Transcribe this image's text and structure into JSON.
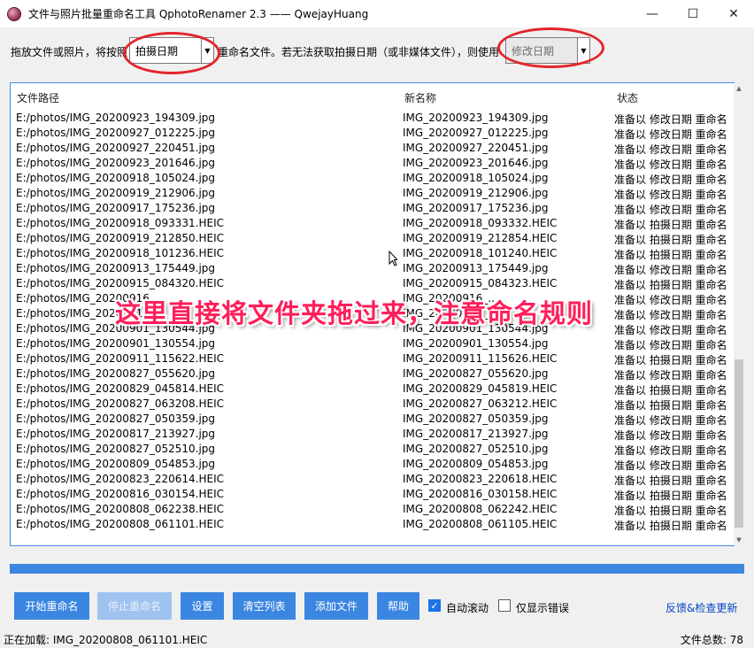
{
  "window": {
    "title": "文件与照片批量重命名工具 QphotoRenamer 2.3 —— QwejayHuang",
    "minimize": "—",
    "maximize": "☐",
    "close": "✕"
  },
  "toprow": {
    "label_left": "拖放文件或照片，将按照",
    "mode_select": "拍摄日期",
    "label_mid": "重命名文件。若无法获取拍摄日期（或非媒体文件），则使用",
    "fallback_select": "修改日期"
  },
  "list": {
    "headers": {
      "path": "文件路径",
      "newname": "新名称",
      "status": "状态"
    },
    "rows": [
      [
        "E:/photos/IMG_20200923_194309.jpg",
        "IMG_20200923_194309.jpg",
        "准备以 修改日期 重命名"
      ],
      [
        "E:/photos/IMG_20200927_012225.jpg",
        "IMG_20200927_012225.jpg",
        "准备以 修改日期 重命名"
      ],
      [
        "E:/photos/IMG_20200927_220451.jpg",
        "IMG_20200927_220451.jpg",
        "准备以 修改日期 重命名"
      ],
      [
        "E:/photos/IMG_20200923_201646.jpg",
        "IMG_20200923_201646.jpg",
        "准备以 修改日期 重命名"
      ],
      [
        "E:/photos/IMG_20200918_105024.jpg",
        "IMG_20200918_105024.jpg",
        "准备以 修改日期 重命名"
      ],
      [
        "E:/photos/IMG_20200919_212906.jpg",
        "IMG_20200919_212906.jpg",
        "准备以 修改日期 重命名"
      ],
      [
        "E:/photos/IMG_20200917_175236.jpg",
        "IMG_20200917_175236.jpg",
        "准备以 修改日期 重命名"
      ],
      [
        "E:/photos/IMG_20200918_093331.HEIC",
        "IMG_20200918_093332.HEIC",
        "准备以 拍摄日期 重命名"
      ],
      [
        "E:/photos/IMG_20200919_212850.HEIC",
        "IMG_20200919_212854.HEIC",
        "准备以 拍摄日期 重命名"
      ],
      [
        "E:/photos/IMG_20200918_101236.HEIC",
        "IMG_20200918_101240.HEIC",
        "准备以 拍摄日期 重命名"
      ],
      [
        "E:/photos/IMG_20200913_175449.jpg",
        "IMG_20200913_175449.jpg",
        "准备以 修改日期 重命名"
      ],
      [
        "E:/photos/IMG_20200915_084320.HEIC",
        "IMG_20200915_084323.HEIC",
        "准备以 拍摄日期 重命名"
      ],
      [
        "E:/photos/IMG_20200916_...",
        "IMG_20200916_...",
        "准备以 修改日期 重命名"
      ],
      [
        "E:/photos/IMG_20200917_...",
        "IMG_20200917_...",
        "准备以 修改日期 重命名"
      ],
      [
        "E:/photos/IMG_20200901_130544.jpg",
        "IMG_20200901_130544.jpg",
        "准备以 修改日期 重命名"
      ],
      [
        "E:/photos/IMG_20200901_130554.jpg",
        "IMG_20200901_130554.jpg",
        "准备以 修改日期 重命名"
      ],
      [
        "E:/photos/IMG_20200911_115622.HEIC",
        "IMG_20200911_115626.HEIC",
        "准备以 拍摄日期 重命名"
      ],
      [
        "E:/photos/IMG_20200827_055620.jpg",
        "IMG_20200827_055620.jpg",
        "准备以 修改日期 重命名"
      ],
      [
        "E:/photos/IMG_20200829_045814.HEIC",
        "IMG_20200829_045819.HEIC",
        "准备以 拍摄日期 重命名"
      ],
      [
        "E:/photos/IMG_20200827_063208.HEIC",
        "IMG_20200827_063212.HEIC",
        "准备以 拍摄日期 重命名"
      ],
      [
        "E:/photos/IMG_20200827_050359.jpg",
        "IMG_20200827_050359.jpg",
        "准备以 修改日期 重命名"
      ],
      [
        "E:/photos/IMG_20200817_213927.jpg",
        "IMG_20200817_213927.jpg",
        "准备以 修改日期 重命名"
      ],
      [
        "E:/photos/IMG_20200827_052510.jpg",
        "IMG_20200827_052510.jpg",
        "准备以 修改日期 重命名"
      ],
      [
        "E:/photos/IMG_20200809_054853.jpg",
        "IMG_20200809_054853.jpg",
        "准备以 修改日期 重命名"
      ],
      [
        "E:/photos/IMG_20200823_220614.HEIC",
        "IMG_20200823_220618.HEIC",
        "准备以 拍摄日期 重命名"
      ],
      [
        "E:/photos/IMG_20200816_030154.HEIC",
        "IMG_20200816_030158.HEIC",
        "准备以 拍摄日期 重命名"
      ],
      [
        "E:/photos/IMG_20200808_062238.HEIC",
        "IMG_20200808_062242.HEIC",
        "准备以 拍摄日期 重命名"
      ],
      [
        "E:/photos/IMG_20200808_061101.HEIC",
        "IMG_20200808_061105.HEIC",
        "准备以 拍摄日期 重命名"
      ]
    ]
  },
  "overlay_caption": "这里直接将文件夹拖过来，注意命名规则",
  "progress": {
    "fraction": 1.0
  },
  "buttons": {
    "start": "开始重命名",
    "stop": "停止重命名",
    "settings": "设置",
    "clear": "清空列表",
    "add": "添加文件",
    "help": "帮助"
  },
  "options": {
    "autoscroll": {
      "label": "自动滚动",
      "checked": true
    },
    "errors_only": {
      "label": "仅显示错误",
      "checked": false
    }
  },
  "feedback_link": "反馈&检查更新",
  "status": {
    "loading": "正在加载: IMG_20200808_061101.HEIC",
    "total": "文件总数: 78"
  },
  "colors": {
    "accent": "#3b86e0",
    "highlight_ring": "#e3242b",
    "caption": "#ff1f5a",
    "link": "#0645c4"
  }
}
